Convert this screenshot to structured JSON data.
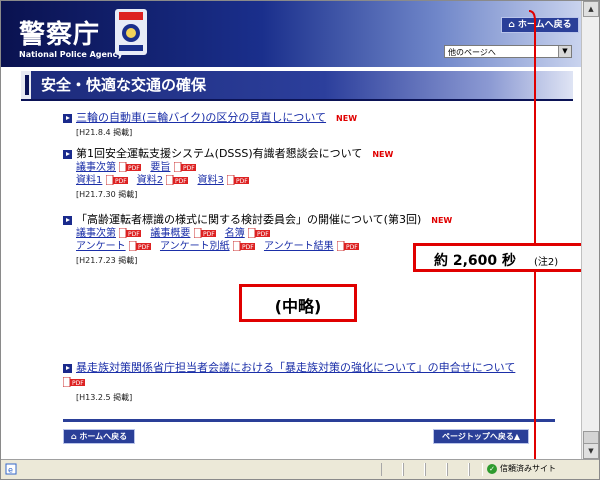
{
  "header": {
    "logo_title": "警察庁",
    "logo_subtitle": "National Police Agency",
    "home_button": "ホームへ戻る",
    "other_pages_select": "他のページへ"
  },
  "page_title": "安全・快適な交通の確保",
  "items": [
    {
      "title": "三輪の自動車(三輪バイク)の区分の見直しについて",
      "is_link": true,
      "new_label": "NEW",
      "date": "[H21.8.4 掲載]"
    },
    {
      "title": "第1回安全運転支援システム(DSSS)有識者懇談会について",
      "is_link": false,
      "new_label": "NEW",
      "links_row1": [
        "議事次第",
        "要旨"
      ],
      "links_row2": [
        "資料1",
        "資料2",
        "資料3"
      ],
      "date": "[H21.7.30 掲載]"
    },
    {
      "title": "「高齢運転者標識の様式に関する検討委員会」の開催について(第3回)",
      "is_link": false,
      "new_label": "NEW",
      "links_row1": [
        "議事次第",
        "議事概要",
        "名簿"
      ],
      "links_row2": [
        "アンケート",
        "アンケート別紙",
        "アンケート結果"
      ],
      "date": "[H21.7.23 掲載]"
    },
    {
      "title": "暴走族対策関係省庁担当者会議における「暴走族対策の強化について」の申合せについて",
      "is_link": true,
      "date": "[H13.2.5 掲載]"
    }
  ],
  "pdf_label": "PDF",
  "annotation_length": {
    "text": "約 2,600 秒",
    "note": "(注2)"
  },
  "annotation_omitted": "(中略)",
  "bottom": {
    "home_button": "ホームへ戻る",
    "page_top_button": "ページトップへ戻る▲"
  },
  "status": {
    "zone": "信頼済みサイト"
  },
  "colors": {
    "accent": "#2a3f98",
    "link": "#1b2fa8",
    "new": "#e00000",
    "annotation": "#e00000"
  }
}
